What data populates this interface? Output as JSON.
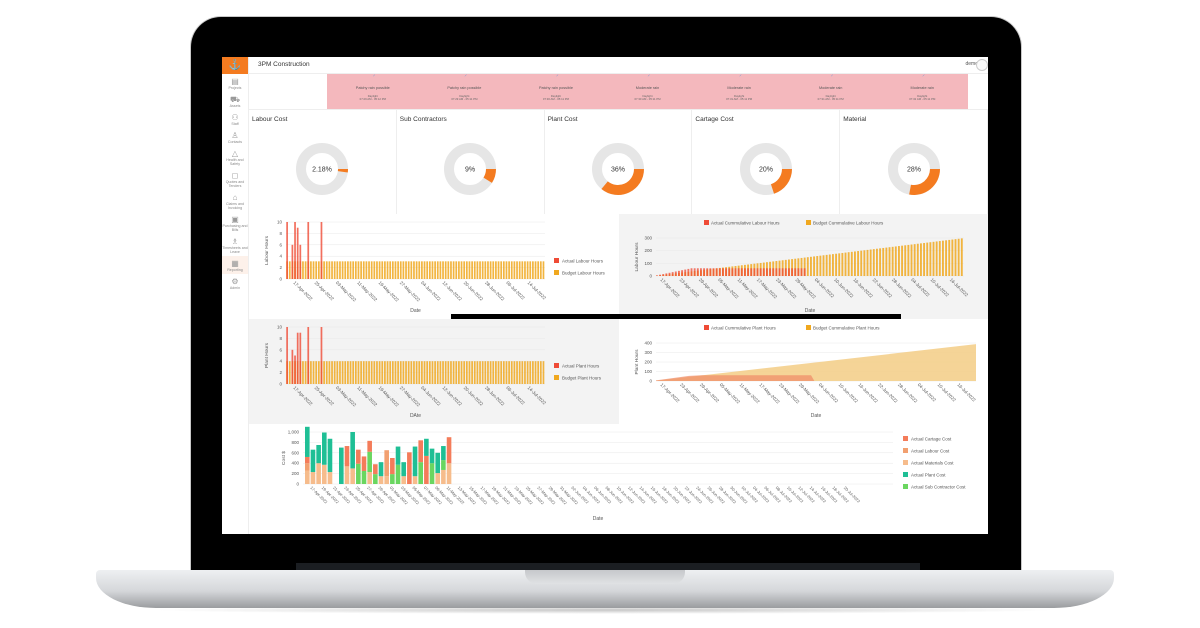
{
  "app": {
    "title": "3PM Construction",
    "user": "demo",
    "logo_icon": "crane-hook-icon"
  },
  "sidebar": {
    "items": [
      {
        "label": "Projects",
        "icon": "projects-icon",
        "glyph": "▤"
      },
      {
        "label": "Assets",
        "icon": "truck-icon",
        "glyph": "⛟"
      },
      {
        "label": "Staff",
        "icon": "staff-icon",
        "glyph": "⚇"
      },
      {
        "label": "Contacts",
        "icon": "contact-icon",
        "glyph": "♙"
      },
      {
        "label": "Health and Safety",
        "icon": "safety-cone-icon",
        "glyph": "△"
      },
      {
        "label": "Quotes and Tenders",
        "icon": "quote-icon",
        "glyph": "◻"
      },
      {
        "label": "Claims and Invoicing",
        "icon": "bank-icon",
        "glyph": "⌂"
      },
      {
        "label": "Purchasing and Bills",
        "icon": "purchase-icon",
        "glyph": "▣"
      },
      {
        "label": "Timesheets and Leave",
        "icon": "timesheet-icon",
        "glyph": "♗"
      },
      {
        "label": "Reporting",
        "icon": "reporting-icon",
        "glyph": "▦",
        "active": true
      },
      {
        "label": "Admin",
        "icon": "gear-icon",
        "glyph": "⚙"
      }
    ]
  },
  "weather": [
    {
      "desc": "Patchy rain possible",
      "label": "Daylight",
      "time": "07:29 AM - 05:12 PM"
    },
    {
      "desc": "Patchy rain possible",
      "label": "Daylight",
      "time": "07:29 AM - 05:11 PM"
    },
    {
      "desc": "Patchy rain possible",
      "label": "Daylight",
      "time": "07:30 AM - 05:11 PM"
    },
    {
      "desc": "Moderate rain",
      "label": "Daylight",
      "time": "07:30 AM - 05:11 PM"
    },
    {
      "desc": "Moderate rain",
      "label": "Daylight",
      "time": "07:31 AM - 05:11 PM"
    },
    {
      "desc": "Moderate rain",
      "label": "Daylight",
      "time": "07:31 AM - 05:11 PM"
    },
    {
      "desc": "Moderate rain",
      "label": "Daylight",
      "time": "07:32 AM - 05:11 PM"
    }
  ],
  "colors": {
    "accent": "#f47b20",
    "weather_bg": "#f4b8bd",
    "donut_track": "#e6e6e6",
    "actual": "#ef4b36",
    "budget": "#f0a81f"
  },
  "chart_data": [
    {
      "type": "pie",
      "title": "Labour Cost",
      "label": "2.18%",
      "value": 2.18
    },
    {
      "type": "pie",
      "title": "Sub Contractors",
      "label": "9%",
      "value": 9
    },
    {
      "type": "pie",
      "title": "Plant Cost",
      "label": "36%",
      "value": 36
    },
    {
      "type": "pie",
      "title": "Cartage Cost",
      "label": "20%",
      "value": 20
    },
    {
      "type": "pie",
      "title": "Material",
      "label": "28%",
      "value": 28
    },
    {
      "type": "bar",
      "title": "",
      "xlabel": "Date",
      "ylabel": "Labour Hours",
      "ylim": [
        0,
        10
      ],
      "yticks": [
        0,
        2,
        4,
        6,
        8,
        10
      ],
      "xticks": [
        "17-Apr-2022",
        "25-Apr-2022",
        "03-May-2022",
        "11-May-2022",
        "19-May-2022",
        "27-May-2022",
        "04-Jun-2022",
        "12-Jun-2022",
        "20-Jun-2022",
        "28-Jun-2022",
        "06-Jul-2022",
        "14-Jul-2022"
      ],
      "legend": "right",
      "n_days": 98,
      "series": [
        {
          "name": "Actual Labour Hours",
          "values_by_day": {
            "0": 10,
            "2": 6,
            "3": 10,
            "4": 9,
            "5": 6,
            "8": 10,
            "13": 10
          }
        },
        {
          "name": "Budget Labour Hours",
          "constant": 3.1
        }
      ]
    },
    {
      "type": "bar",
      "title": "",
      "xlabel": "Date",
      "ylabel": "Labour Hours",
      "ylim": [
        0,
        300
      ],
      "yticks": [
        0,
        100,
        200,
        300
      ],
      "xticks": [
        "17-Apr-2022",
        "23-Apr-2022",
        "29-Apr-2022",
        "05-May-2022",
        "11-May-2022",
        "17-May-2022",
        "23-May-2022",
        "29-May-2022",
        "04-Jun-2022",
        "10-Jun-2022",
        "16-Jun-2022",
        "22-Jun-2022",
        "28-Jun-2022",
        "04-Jul-2022",
        "10-Jul-2022",
        "16-Jul-2022"
      ],
      "legend": "top",
      "n_days": 98,
      "series": [
        {
          "name": "Actual Cummulative Labour Hours",
          "final": 61,
          "end_day": 47
        },
        {
          "name": "Budget Cummulative Labour Hours",
          "final": 297
        }
      ]
    },
    {
      "type": "bar",
      "title": "",
      "xlabel": "DAte",
      "ylabel": "Plant Hours",
      "ylim": [
        0,
        10
      ],
      "yticks": [
        0,
        2,
        4,
        6,
        8,
        10
      ],
      "xticks": [
        "17-Apr-2022",
        "25-Apr-2022",
        "03-May-2022",
        "11-May-2022",
        "19-May-2022",
        "27-May-2022",
        "04-Jun-2022",
        "12-Jun-2022",
        "20-Jun-2022",
        "28-Jun-2022",
        "06-Jul-2022",
        "14-Jul-2022"
      ],
      "legend": "right",
      "n_days": 98,
      "series": [
        {
          "name": "Actual Plant Hours",
          "values_by_day": {
            "0": 10,
            "2": 6,
            "3": 5,
            "4": 9,
            "5": 9,
            "8": 10,
            "13": 10
          }
        },
        {
          "name": "Budget Plant Hours",
          "constant": 4
        }
      ]
    },
    {
      "type": "area",
      "title": "",
      "xlabel": "Date",
      "ylabel": "Plant Hours",
      "ylim": [
        0,
        400
      ],
      "yticks": [
        0,
        100,
        200,
        300,
        400
      ],
      "xticks": [
        "17-Apr-2022",
        "23-Apr-2022",
        "29-Apr-2022",
        "05-May-2022",
        "11-May-2022",
        "17-May-2022",
        "23-May-2022",
        "29-May-2022",
        "04-Jun-2022",
        "10-Jun-2022",
        "16-Jun-2022",
        "22-Jun-2022",
        "28-Jun-2022",
        "04-Jul-2022",
        "10-Jul-2022",
        "16-Jul-2022"
      ],
      "legend": "top",
      "n_days": 98,
      "series": [
        {
          "name": "Actual Cummulative Plant Hours",
          "final": 60,
          "end_day": 47
        },
        {
          "name": "Budget Cummulative Plant Hours",
          "final": 388
        }
      ]
    },
    {
      "type": "bar",
      "title": "",
      "xlabel": "Date",
      "ylabel": "Cost $",
      "ylim": [
        0,
        1000
      ],
      "yticks": [
        "0",
        "200",
        "400",
        "600",
        "800",
        "1,000"
      ],
      "xticks": [
        "17-Apr-2022",
        "19-Apr-2022",
        "21-Apr-2022",
        "23-Apr-2022",
        "25-Apr-2022",
        "27-Apr-2022",
        "29-Apr-2022",
        "01-May-2022",
        "03-May-2022",
        "05-May-2022",
        "07-May-2022",
        "09-May-2022",
        "11-May-2022",
        "13-May-2022",
        "15-May-2022",
        "17-May-2022",
        "19-May-2022",
        "21-May-2022",
        "23-May-2022",
        "25-May-2022",
        "27-May-2022",
        "29-May-2022",
        "31-May-2022",
        "02-Jun-2022",
        "04-Jun-2022",
        "06-Jun-2022",
        "08-Jun-2022",
        "10-Jun-2022",
        "12-Jun-2022",
        "14-Jun-2022",
        "16-Jun-2022",
        "18-Jun-2022",
        "20-Jun-2022",
        "22-Jun-2022",
        "24-Jun-2022",
        "26-Jun-2022",
        "28-Jun-2022",
        "30-Jun-2022",
        "02-Jul-2022",
        "04-Jul-2022",
        "06-Jul-2022",
        "08-Jul-2022",
        "10-Jul-2022",
        "12-Jul-2022",
        "14-Jul-2022",
        "16-Jul-2022",
        "18-Jul-2022",
        "20-Jul-2022"
      ],
      "legend": "right",
      "stacked": true,
      "series": [
        {
          "name": "Actual Cartage Cost",
          "color": "#f47c5a"
        },
        {
          "name": "Actual Labour Cost",
          "color": "#f2a070"
        },
        {
          "name": "Actual Materials Cost",
          "color": "#f6bc8c"
        },
        {
          "name": "Actual Plant Cost",
          "color": "#1fbf95"
        },
        {
          "name": "Actual Sub Contractor Cost",
          "color": "#6ad660"
        }
      ],
      "bars": [
        {
          "day": 0,
          "Materials": 260,
          "Labour": 140,
          "Cartage": 120,
          "Plant": 580
        },
        {
          "day": 1,
          "Materials": 230,
          "Plant": 430
        },
        {
          "day": 2,
          "Materials": 400,
          "Plant": 350
        },
        {
          "day": 3,
          "Materials": 370,
          "Plant": 620
        },
        {
          "day": 4,
          "Materials": 230,
          "Plant": 640
        },
        {
          "day": 6,
          "Plant": 700
        },
        {
          "day": 7,
          "Cartage": 390,
          "Materials": 340
        },
        {
          "day": 8,
          "Materials": 300,
          "Plant": 700
        },
        {
          "day": 9,
          "Sub": 390,
          "Cartage": 270
        },
        {
          "day": 10,
          "Sub": 250,
          "Cartage": 280
        },
        {
          "day": 11,
          "Sub": 390,
          "Cartage": 210,
          "Materials": 230
        },
        {
          "day": 12,
          "Sub": 190,
          "Cartage": 190
        },
        {
          "day": 13,
          "Materials": 150,
          "Plant": 270
        },
        {
          "day": 14,
          "Materials": 150,
          "Labour": 500
        },
        {
          "day": 15,
          "Sub": 190,
          "Cartage": 310
        },
        {
          "day": 16,
          "Sub": 370,
          "Plant": 350
        },
        {
          "day": 17,
          "Materials": 150,
          "Plant": 270
        },
        {
          "day": 18,
          "Cartage": 610
        },
        {
          "day": 19,
          "Materials": 150,
          "Plant": 570
        },
        {
          "day": 20,
          "Sub": 420,
          "Cartage": 420
        },
        {
          "day": 21,
          "Plant": 330,
          "Cartage": 540
        },
        {
          "day": 22,
          "Sub": 400,
          "Plant": 280
        },
        {
          "day": 23,
          "Materials": 210,
          "Plant": 390
        },
        {
          "day": 24,
          "Sub": 190,
          "Materials": 270,
          "Plant": 270
        },
        {
          "day": 25,
          "Materials": 400,
          "Cartage": 500
        }
      ]
    }
  ]
}
